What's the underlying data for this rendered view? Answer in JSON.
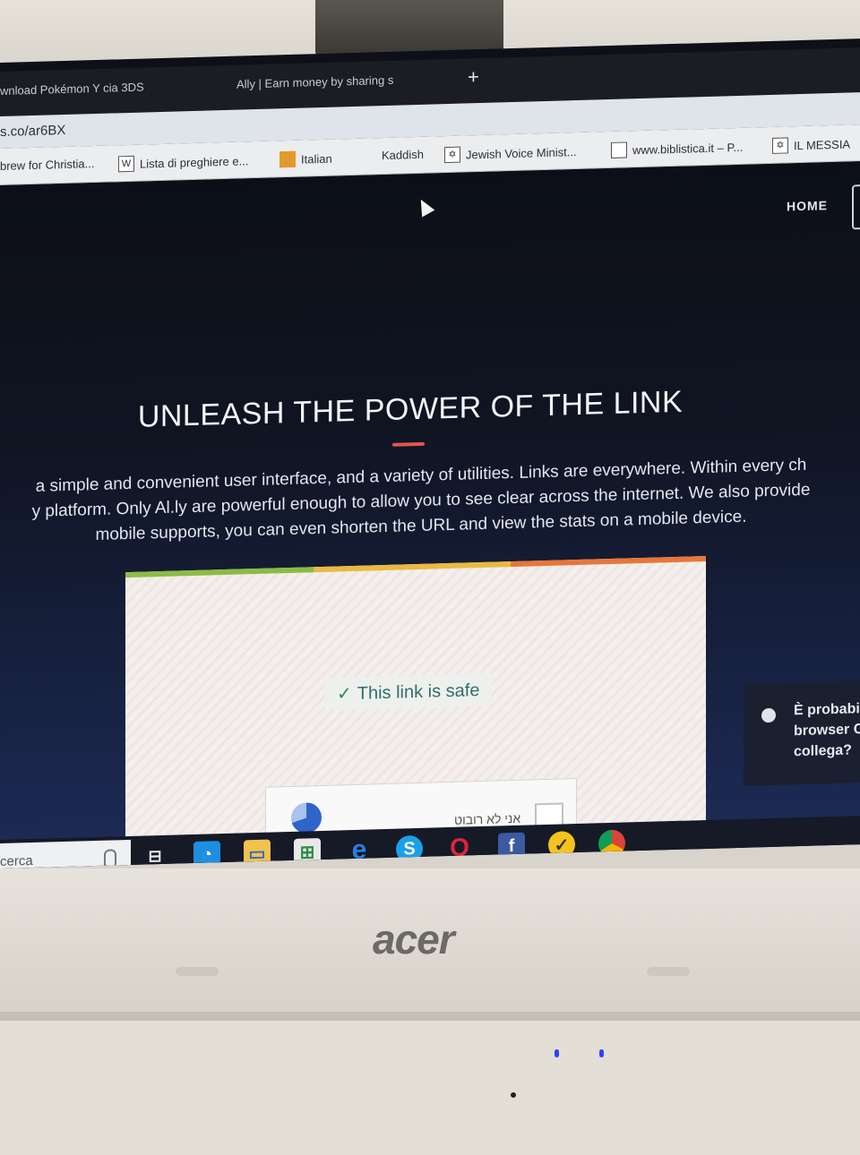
{
  "tabs": [
    "wnload Pokémon Y cia 3DS",
    "Ally | Earn money by sharing s"
  ],
  "new_tab_symbol": "+",
  "address_bar": "s.co/ar6BX",
  "bookmarks": [
    {
      "label": "brew for Christia...",
      "icon": ""
    },
    {
      "label": "Lista di preghiere e...",
      "icon": "W"
    },
    {
      "label": "Italian",
      "icon": "orange-square"
    },
    {
      "label": "Kaddish",
      "icon": ""
    },
    {
      "label": "Jewish Voice Minist...",
      "icon": "star-of-david"
    },
    {
      "label": "www.biblistica.it – P...",
      "icon": "page"
    },
    {
      "label": "IL MESSIA",
      "icon": "star-of-david"
    }
  ],
  "nav": {
    "home": "HOME"
  },
  "hero": {
    "title": "UNLEASH THE POWER OF THE LINK",
    "lines": [
      "a simple and convenient user interface, and a variety of utilities. Links are everywhere. Within every ch",
      "y platform. Only Al.ly are powerful enough to allow you to see clear across the internet. We also provide",
      "mobile supports, you can even shorten the URL and view the stats on a mobile device."
    ]
  },
  "card": {
    "status": "This link is safe",
    "status_icon": "check-icon",
    "stripe_colors": [
      "#8dbb44",
      "#e9b941",
      "#e8763a"
    ],
    "captcha_label": "אני לא רובוט"
  },
  "notification": {
    "text": "È probabi\nbrowser C\ncollega?"
  },
  "taskbar": {
    "search_placeholder": "cerca",
    "apps": [
      "task-view",
      "messenger",
      "file-explorer",
      "store",
      "edge",
      "skype",
      "opera",
      "facebook",
      "norton",
      "chrome"
    ]
  },
  "device": {
    "brand": "acer"
  }
}
